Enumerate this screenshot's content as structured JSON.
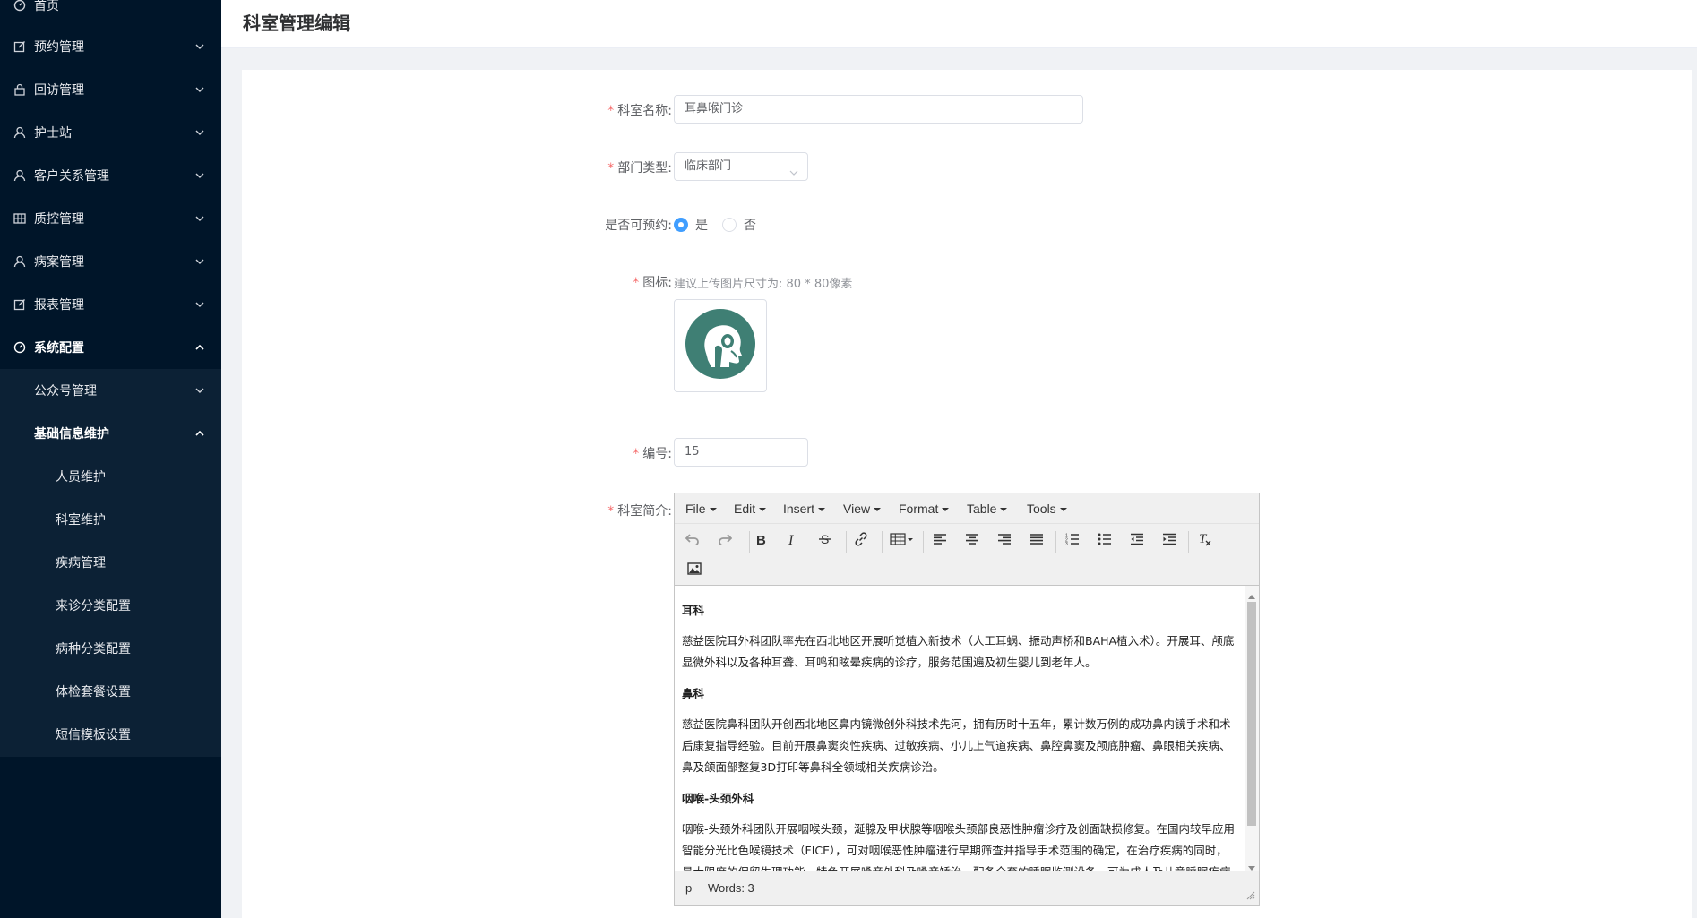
{
  "sidebar": {
    "items": [
      {
        "label": "首页",
        "icon": "dashboard-icon"
      },
      {
        "label": "预约管理",
        "icon": "edit-icon"
      },
      {
        "label": "回访管理",
        "icon": "lock-icon"
      },
      {
        "label": "护士站",
        "icon": "user-icon"
      },
      {
        "label": "客户关系管理",
        "icon": "user-icon"
      },
      {
        "label": "质控管理",
        "icon": "grid-icon"
      },
      {
        "label": "病案管理",
        "icon": "user-icon"
      },
      {
        "label": "报表管理",
        "icon": "edit-icon"
      },
      {
        "label": "系统配置",
        "icon": "dashboard-icon"
      }
    ],
    "sub_items": [
      {
        "label": "公众号管理"
      },
      {
        "label": "基础信息维护"
      }
    ],
    "subsub_items": [
      {
        "label": "人员维护"
      },
      {
        "label": "科室维护"
      },
      {
        "label": "疾病管理"
      },
      {
        "label": "来诊分类配置"
      },
      {
        "label": "病种分类配置"
      },
      {
        "label": "体检套餐设置"
      },
      {
        "label": "短信模板设置"
      }
    ]
  },
  "header": {
    "title": "科室管理编辑"
  },
  "form": {
    "name_label": "科室名称:",
    "name_value": "耳鼻喉门诊",
    "type_label": "部门类型:",
    "type_value": "临床部门",
    "bookable_label": "是否可预约:",
    "bookable_yes": "是",
    "bookable_no": "否",
    "bookable_selected": "是",
    "icon_label": "图标:",
    "icon_hint": "建议上传图片尺寸为: 80 * 80像素",
    "code_label": "编号:",
    "code_value": "15",
    "intro_label": "科室简介:",
    "required_mark": "*"
  },
  "editor": {
    "menus": [
      "File",
      "Edit",
      "Insert",
      "View",
      "Format",
      "Table",
      "Tools"
    ],
    "content": {
      "h1": "耳科",
      "p1": "慈益医院耳外科团队率先在西北地区开展听觉植入新技术（人工耳蜗、振动声桥和BAHA植入术）。开展耳、颅底显微外科以及各种耳聋、耳鸣和眩晕疾病的诊疗，服务范围遍及初生婴儿到老年人。",
      "h2": "鼻科",
      "p2": "慈益医院鼻科团队开创西北地区鼻内镜微创外科技术先河，拥有历时十五年，累计数万例的成功鼻内镜手术和术后康复指导经验。目前开展鼻窦炎性疾病、过敏疾病、小儿上气道疾病、鼻腔鼻窦及颅底肿瘤、鼻眼相关疾病、鼻及颌面部整复3D打印等鼻科全领域相关疾病诊治。",
      "h3": "咽喉-头颈外科",
      "p3": "咽喉-头颈外科团队开展咽喉头颈，涎腺及甲状腺等咽喉头颈部良恶性肿瘤诊疗及创面缺损修复。在国内较早应用智能分光比色喉镜技术（FICE），可对咽喉恶性肿瘤进行早期筛查并指导手术范围的确定，在治疗疾病的同时，最大限度的保留生理功能。特色开展嗓音外科及嗓音矫治。配备全套的睡眠监测设备，可为成人及儿童睡眠疾病的诊治提供稳"
    },
    "status_path": "p",
    "status_words": "Words: 3"
  },
  "colors": {
    "sidebar_bg": "#001529",
    "accent": "#409eff",
    "required": "#f56c6c",
    "logo_teal": "#3f7f74"
  }
}
